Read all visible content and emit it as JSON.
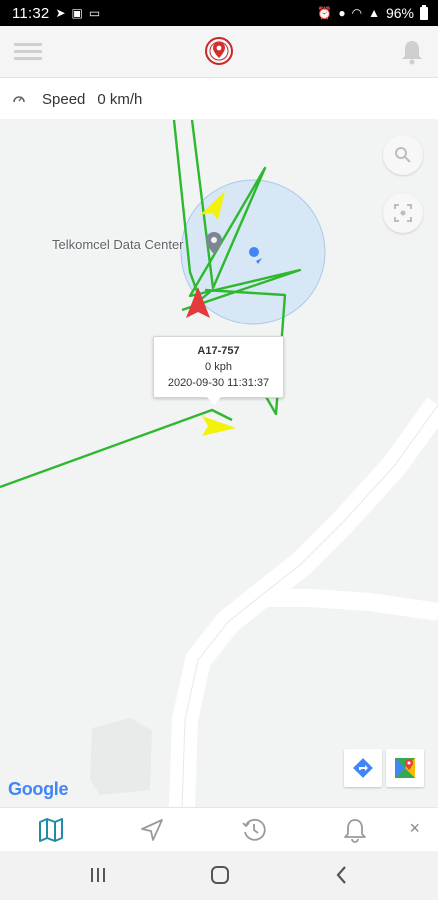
{
  "status_bar": {
    "time": "11:32",
    "battery": "96%"
  },
  "header": {
    "icons": [
      "menu-icon",
      "gps-logo-icon",
      "bell-icon"
    ]
  },
  "speed": {
    "label": "Speed",
    "value": "0 km/h"
  },
  "map": {
    "place_label": "Telkomcel Data Center",
    "attribution": "Google",
    "info_window": {
      "plate": "A17-757",
      "speed": "0 kph",
      "datetime": "2020-09-30 11:31:37"
    },
    "colors": {
      "track": "#2eb82e",
      "accuracy_fill": "#cfe3f5",
      "vehicle_marker": "#e23b3b",
      "waypoint_marker": "#f2f20a"
    }
  },
  "bottom_nav": {
    "items": [
      "map-icon",
      "navigation-icon",
      "history-icon",
      "notifications-icon",
      "close-icon"
    ],
    "close_label": "×"
  }
}
